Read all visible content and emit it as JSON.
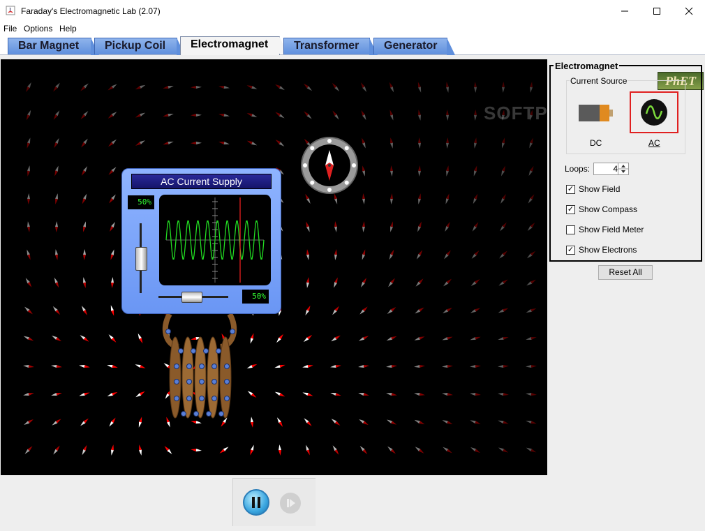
{
  "window": {
    "title": "Faraday's Electromagnetic Lab (2.07)"
  },
  "menu": [
    "File",
    "Options",
    "Help"
  ],
  "tabs": [
    "Bar Magnet",
    "Pickup Coil",
    "Electromagnet",
    "Transformer",
    "Generator"
  ],
  "active_tab": "Electromagnet",
  "logo_text": "PhET",
  "watermark": "SOFTPEDIA",
  "ac_supply": {
    "title": "AC Current Supply",
    "amplitude": "50%",
    "frequency": "50%"
  },
  "control_panel": {
    "title": "Electromagnet",
    "current_source_title": "Current Source",
    "dc_label": "DC",
    "ac_label": "AC",
    "selected_source": "AC",
    "loops_label": "Loops:",
    "loops_value": "4",
    "checkboxes": [
      {
        "label": "Show Field",
        "checked": true
      },
      {
        "label": "Show Compass",
        "checked": true
      },
      {
        "label": "Show Field Meter",
        "checked": false
      },
      {
        "label": "Show Electrons",
        "checked": true
      }
    ],
    "reset_label": "Reset All"
  },
  "colors": {
    "tab": "#5f8fdc",
    "selection": "#e02020",
    "wave": "#22dd22",
    "readout": "#33ff33"
  }
}
